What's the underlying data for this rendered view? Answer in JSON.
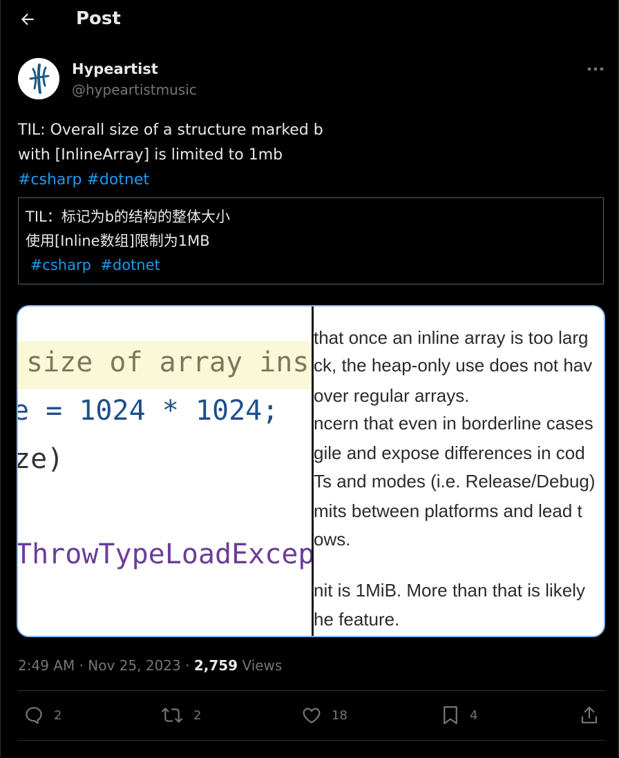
{
  "header": {
    "title": "Post"
  },
  "author": {
    "name": "Hypeartist",
    "handle": "@hypeartistmusic"
  },
  "post": {
    "line1": "TIL: Overall size of a structure marked b",
    "line2": "with [InlineArray] is limited to 1mb",
    "hashtags": [
      "#csharp",
      "#dotnet"
    ]
  },
  "translation": {
    "line1": "TIL：标记为b的结构的整体大小",
    "line2": "使用[Inline数组]限制为1MB",
    "hashtags": [
      "#csharp",
      "#dotnet"
    ]
  },
  "media": {
    "code_lines": [
      "size of array ins",
      "e = 1024 * 1024;",
      "ze)",
      "ThrowTypeLoadExcep"
    ],
    "article_lines": [
      "that once an inline array is too larg",
      "ck, the heap-only use does not hav",
      "over regular arrays.",
      "ncern that even in borderline cases",
      "gile and expose differences in cod",
      "Ts and modes (i.e. Release/Debug)",
      "mits between platforms and lead t",
      "ows.",
      "nit is 1MiB. More than that is likely",
      "he feature."
    ]
  },
  "meta": {
    "time": "2:49 AM",
    "date": "Nov 25, 2023",
    "views_count": "2,759",
    "views_label": "Views"
  },
  "actions": {
    "replies": "2",
    "reposts": "2",
    "likes": "18",
    "bookmarks": "4"
  },
  "icons": [
    "back-arrow-icon",
    "avatar-logo-icon",
    "more-icon",
    "reply-icon",
    "repost-icon",
    "like-icon",
    "bookmark-icon",
    "share-icon"
  ],
  "colors": {
    "background": "#000000",
    "text": "#e7e9ea",
    "secondary": "#71767b",
    "link": "#1d9bf0",
    "media_border": "#8ab4f8"
  }
}
